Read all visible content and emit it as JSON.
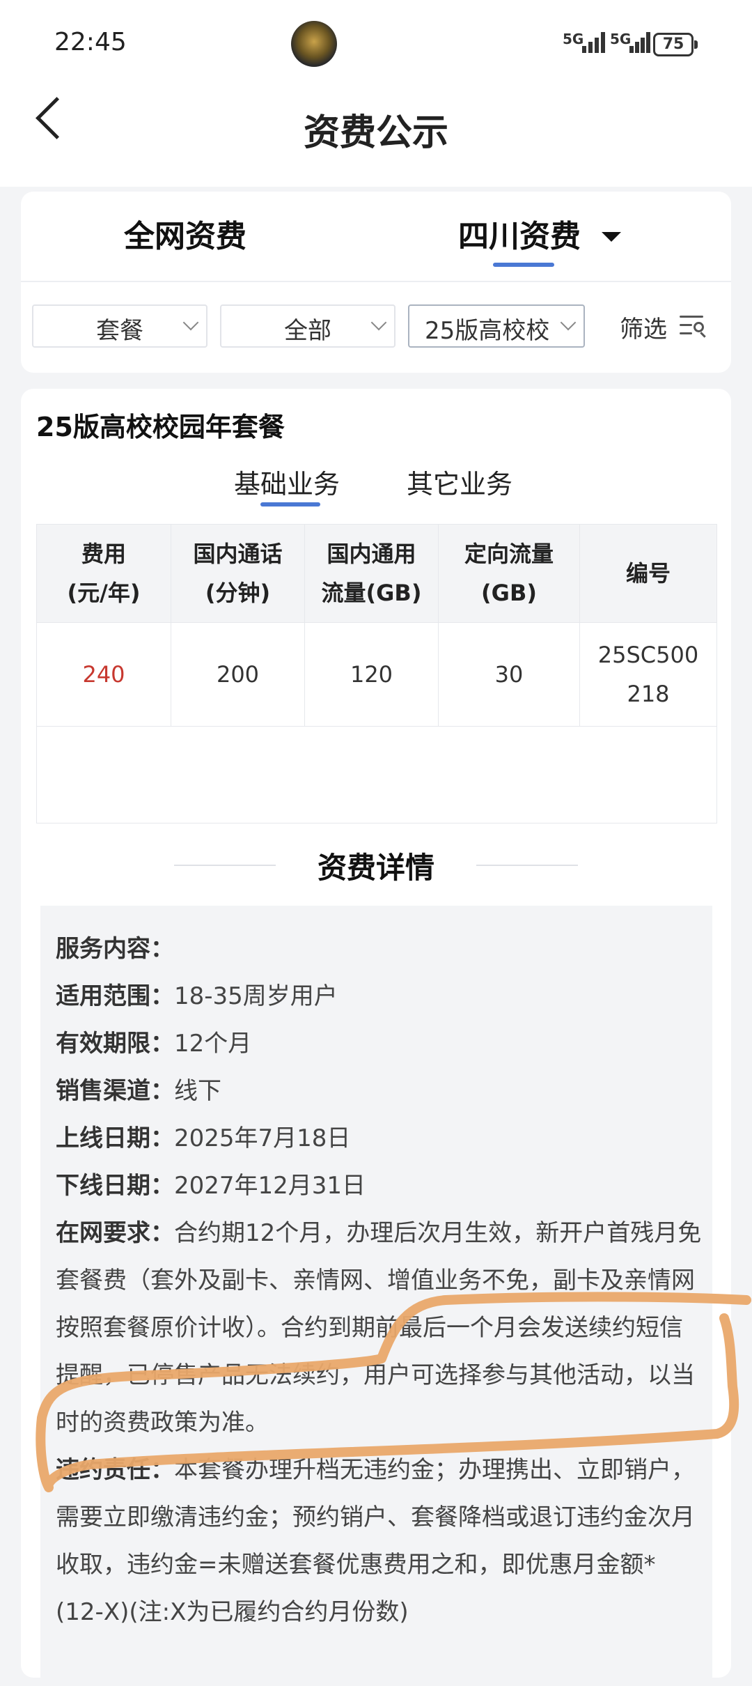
{
  "status_bar": {
    "time": "22:45",
    "signal_1": "5G",
    "signal_2": "5G",
    "battery": "75"
  },
  "header": {
    "title": "资费公示",
    "back_icon": "chevron-left-icon"
  },
  "tabs": {
    "left": "全网资费",
    "right": "四川资费",
    "active": "四川资费"
  },
  "filters": {
    "type": "套餐",
    "scope": "全部",
    "plan": "25版高校校",
    "filter_label": "筛选"
  },
  "plan": {
    "name": "25版高校校园年套餐",
    "subtabs": [
      "基础业务",
      "其它业务"
    ],
    "active_subtab": "基础业务",
    "table": {
      "headers": [
        [
          "费用",
          "(元/年)"
        ],
        [
          "国内通话",
          "(分钟)"
        ],
        [
          "国内通用",
          "流量(GB)"
        ],
        [
          "定向流量",
          "(GB)"
        ],
        [
          "编号",
          ""
        ]
      ],
      "row": {
        "price": "240",
        "minutes": "200",
        "general_data": "120",
        "directed_data": "30",
        "code_line1": "25SC500",
        "code_line2": "218"
      }
    }
  },
  "details": {
    "heading": "资费详情",
    "rows": [
      {
        "label": "服务内容：",
        "value": ""
      },
      {
        "label": "适用范围：",
        "value": "18-35周岁用户"
      },
      {
        "label": "有效期限：",
        "value": "12个月"
      },
      {
        "label": "销售渠道：",
        "value": "线下"
      },
      {
        "label": "上线日期：",
        "value": "2025年7月18日"
      },
      {
        "label": "下线日期：",
        "value": "2027年12月31日"
      },
      {
        "label": "在网要求：",
        "value": "合约期12个月，办理后次月生效，新开户首残月免套餐费（套外及副卡、亲情网、增值业务不免，副卡及亲情网按照套餐原价计收）。合约到期前最后一个月会发送续约短信提醒，已停售产品无法续约，用户可选择参与其他活动，以当时的资费政策为准。"
      },
      {
        "label": "违约责任：",
        "value": "本套餐办理升档无违约金；办理携出、立即销户，需要立即缴清违约金；预约销户、套餐降档或退订违约金次月收取，违约金=未赠送套餐优惠费用之和，即优惠月金额*(12-X)(注:X为已履约合约月份数)"
      }
    ]
  },
  "colors": {
    "accent": "#4a78d4",
    "price": "#c7382f",
    "highlight_marker": "#e9a86a"
  }
}
